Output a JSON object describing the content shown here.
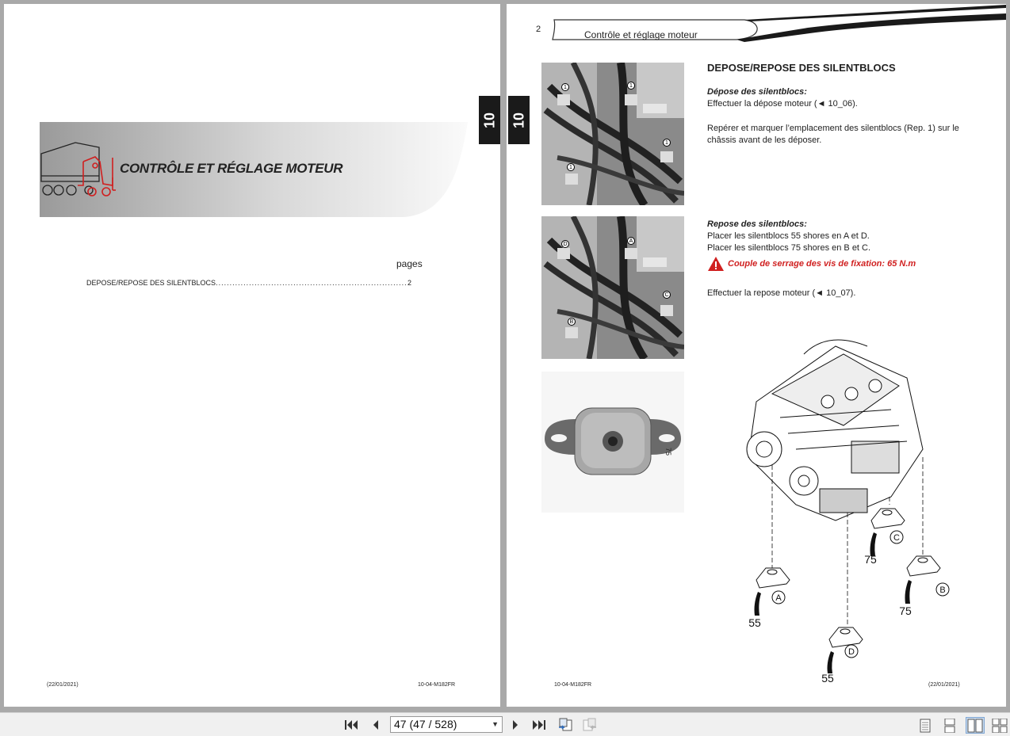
{
  "left_page": {
    "title": "CONTRÔLE ET RÉGLAGE MOTEUR",
    "pages_label": "pages",
    "toc": [
      {
        "entry": "DEPOSE/REPOSE DES SILENTBLOCS",
        "dots": ".....................................................................................",
        "page": "2"
      }
    ],
    "footer_date": "(22/01/2021)",
    "footer_code": "10-04-M182FR"
  },
  "chapter_tab": "10",
  "right_page": {
    "page_number": "2",
    "running_head": "Contrôle et réglage moteur",
    "section_title": "DEPOSE/REPOSE DES SILENTBLOCS",
    "depose_heading": "Dépose des silentblocs:",
    "depose_line": "Effectuer la dépose moteur (◄ 10_06).",
    "reperer_line": "Repérer et marquer l’emplacement des silentblocs (Rep. 1) sur le châssis avant de les déposer.",
    "repose_heading": "Repose des silentblocs:",
    "repose_line1": "Placer les silentblocs 55 shores en A et D.",
    "repose_line2": "Placer les silentblocs 75 shores en B et C.",
    "warning": "Couple de serrage des vis de fixation: 65 N.m",
    "repose_moteur": "Effectuer la repose moteur (◄ 10_07).",
    "photo1_markers": [
      "1",
      "1",
      "1",
      "1"
    ],
    "photo2_markers": [
      "D",
      "A",
      "C",
      "B"
    ],
    "mount_marking": "75",
    "diagram_labels": {
      "a": "A",
      "b": "B",
      "c": "C",
      "d": "D",
      "v55a": "55",
      "v55d": "55",
      "v75b": "75",
      "v75c": "75"
    },
    "footer_code": "10-04-M182FR",
    "footer_date": "(22/01/2021)"
  },
  "toolbar": {
    "page_display": "47 (47 / 528)"
  },
  "colors": {
    "accent_red": "#d02020",
    "tab_black": "#1a1a1a",
    "viewer_bg": "#a9a9a9"
  }
}
